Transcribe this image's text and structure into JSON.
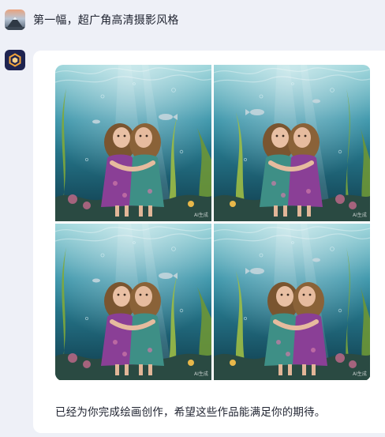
{
  "user": {
    "message": "第一幅，超广角高清摄影风格"
  },
  "assistant": {
    "image_grid": [
      {
        "alt": "underwater twins image 1",
        "watermark": "AI生成"
      },
      {
        "alt": "underwater twins image 2",
        "watermark": "AI生成"
      },
      {
        "alt": "underwater twins image 3",
        "watermark": "AI生成"
      },
      {
        "alt": "underwater twins image 4",
        "watermark": "AI生成"
      }
    ],
    "reply": "已经为你完成绘画创作，希望这些作品能满足你的期待。"
  },
  "colors": {
    "page_bg": "#eef0f7",
    "card_bg": "#ffffff",
    "bot_avatar_bg": "#1e2350",
    "bot_avatar_accent": "#f2a33a",
    "water_top": "#7fc4cf",
    "water_deep": "#0f3a4a"
  }
}
